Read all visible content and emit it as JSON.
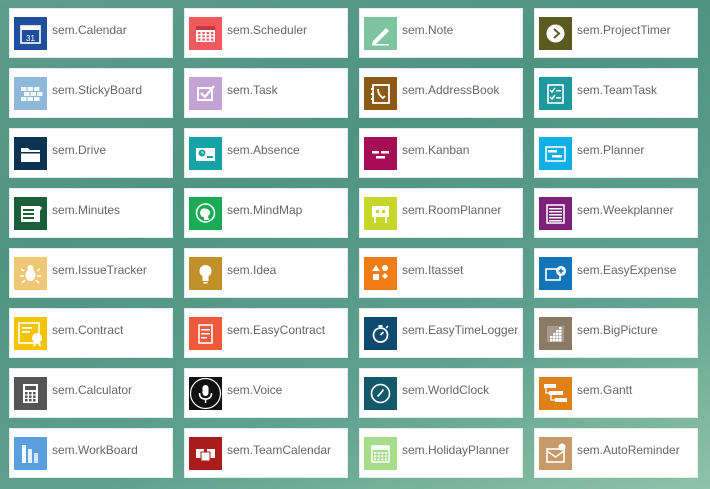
{
  "apps": [
    {
      "label": "sem.Calendar",
      "icon": "calendar-icon",
      "color": "#1f4e9c"
    },
    {
      "label": "sem.Scheduler",
      "icon": "scheduler-icon",
      "color": "#f05a5f"
    },
    {
      "label": "sem.Note",
      "icon": "pencil-icon",
      "color": "#7fc4a0"
    },
    {
      "label": "sem.ProjectTimer",
      "icon": "play-icon",
      "color": "#5b5b1f"
    },
    {
      "label": "sem.StickyBoard",
      "icon": "bricks-icon",
      "color": "#8db8da"
    },
    {
      "label": "sem.Task",
      "icon": "checkbox-icon",
      "color": "#c3a3d6"
    },
    {
      "label": "sem.AddressBook",
      "icon": "addressbook-icon",
      "color": "#8b5a16"
    },
    {
      "label": "sem.TeamTask",
      "icon": "checklist-icon",
      "color": "#1e9a9e"
    },
    {
      "label": "sem.Drive",
      "icon": "folder-icon",
      "color": "#0d3352"
    },
    {
      "label": "sem.Absence",
      "icon": "absence-icon",
      "color": "#17a2a6"
    },
    {
      "label": "sem.Kanban",
      "icon": "kanban-icon",
      "color": "#a60d55"
    },
    {
      "label": "sem.Planner",
      "icon": "planner-icon",
      "color": "#12aee6"
    },
    {
      "label": "sem.Minutes",
      "icon": "minutes-icon",
      "color": "#1b5e3a"
    },
    {
      "label": "sem.MindMap",
      "icon": "mindmap-icon",
      "color": "#1cab55"
    },
    {
      "label": "sem.RoomPlanner",
      "icon": "roomplanner-icon",
      "color": "#c7d62a"
    },
    {
      "label": "sem.Weekplanner",
      "icon": "weekplanner-icon",
      "color": "#7c2078"
    },
    {
      "label": "sem.IssueTracker",
      "icon": "bug-icon",
      "color": "#eec876"
    },
    {
      "label": "sem.Idea",
      "icon": "lightbulb-icon",
      "color": "#c0912a"
    },
    {
      "label": "sem.Itasset",
      "icon": "shapes-icon",
      "color": "#f07c18"
    },
    {
      "label": "sem.EasyExpense",
      "icon": "expense-icon",
      "color": "#1474b8"
    },
    {
      "label": "sem.Contract",
      "icon": "certificate-icon",
      "color": "#f4c400"
    },
    {
      "label": "sem.EasyContract",
      "icon": "document-icon",
      "color": "#f05a3c"
    },
    {
      "label": "sem.EasyTimeLogger",
      "icon": "stopwatch-icon",
      "color": "#0e4a6e"
    },
    {
      "label": "sem.BigPicture",
      "icon": "bigpicture-icon",
      "color": "#8a7a66"
    },
    {
      "label": "sem.Calculator",
      "icon": "calculator-icon",
      "color": "#555555"
    },
    {
      "label": "sem.Voice",
      "icon": "microphone-icon",
      "color": "#111111"
    },
    {
      "label": "sem.WorldClock",
      "icon": "worldclock-icon",
      "color": "#14596b"
    },
    {
      "label": "sem.Gantt",
      "icon": "gantt-icon",
      "color": "#e0801a"
    },
    {
      "label": "sem.WorkBoard",
      "icon": "workboard-icon",
      "color": "#5aa0e0"
    },
    {
      "label": "sem.TeamCalendar",
      "icon": "teamcalendar-icon",
      "color": "#a81c1c"
    },
    {
      "label": "sem.HolidayPlanner",
      "icon": "holidayplanner-icon",
      "color": "#a7dc8a"
    },
    {
      "label": "sem.AutoReminder",
      "icon": "reminder-icon",
      "color": "#c89a6a"
    }
  ]
}
